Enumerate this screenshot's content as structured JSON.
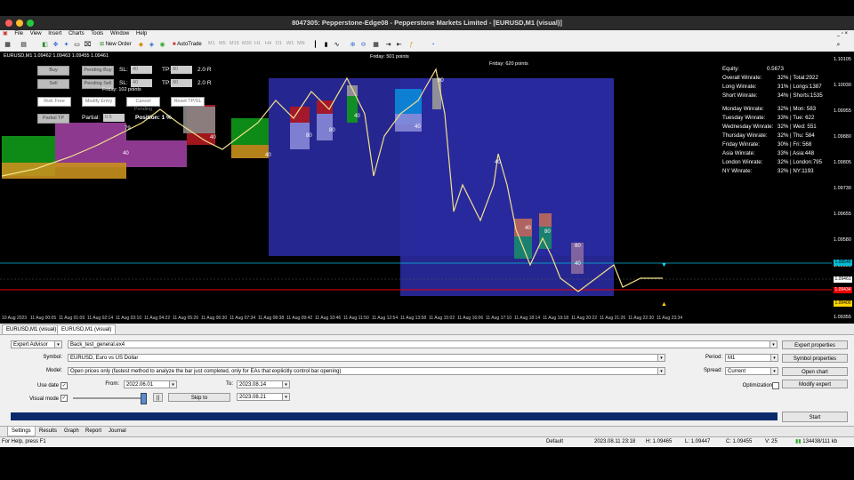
{
  "window": {
    "title": "8047305: Pepperstone-Edge08 - Pepperstone Markets Limited - [EURUSD,M1 (visual)]"
  },
  "menu": [
    "File",
    "View",
    "Insert",
    "Charts",
    "Tools",
    "Window",
    "Help"
  ],
  "toolbar": {
    "new_order": "New Order",
    "autotrade": "AutoTrade",
    "timeframes": [
      "M1",
      "M5",
      "M15",
      "M30",
      "H1",
      "H4",
      "D1",
      "W1",
      "MN"
    ]
  },
  "chart": {
    "symbol_label": "EURUSD,M1 1.09462 1.09463 1.09455 1.09461",
    "panel": {
      "buy": "Buy",
      "sell": "Sell",
      "pending_buy": "Pending Buy",
      "pending_sell": "Pending Sell",
      "sl_label": "SL:",
      "tp_label": "TP:",
      "sl_buy": "40",
      "sl_sell": "40",
      "tp_buy": "80",
      "tp_sell": "80",
      "rr_buy": "2.0 R",
      "rr_sell": "2.0 R",
      "risk_free": "Risk Free",
      "modify_entry": "Modify Entry",
      "cancel_pending": "Cancel Pending",
      "reset_tpsl": "Reset TP/SL",
      "partial_tp": "Partial TP",
      "partial_label": "Partial:",
      "partial_value": "0.5",
      "position_label": "Position: 1 %"
    },
    "annotations": {
      "friday1": "Friday: 102 points",
      "friday2": "Friday: 501 points",
      "friday3": "Friday: 620 points"
    },
    "box_labels": [
      "40",
      "79",
      "40",
      "40",
      "80",
      "80",
      "40",
      "80",
      "40",
      "40",
      "40",
      "80",
      "80",
      "40",
      "80"
    ],
    "stats": [
      {
        "label": "Equity:",
        "value": "0.5673",
        "rest": ""
      },
      {
        "label": "Overall Winrate:",
        "value": "32%",
        "rest": "| Total:2922"
      },
      {
        "label": "Long Winrate:",
        "value": "31%",
        "rest": "| Longs:1387"
      },
      {
        "label": "Short Winrate:",
        "value": "34%",
        "rest": "| Shorts:1535"
      },
      {
        "label": "Monday Winrate:",
        "value": "32%",
        "rest": "| Mon: 583"
      },
      {
        "label": "Tuesday Winrate:",
        "value": "33%",
        "rest": "| Tue: 622"
      },
      {
        "label": "Wednesday Winrate:",
        "value": "32%",
        "rest": "| Wed: 551"
      },
      {
        "label": "Thursday Winrate:",
        "value": "32%",
        "rest": "| Thu: 584"
      },
      {
        "label": "Friday Winrate:",
        "value": "30%",
        "rest": "| Fri: 568"
      },
      {
        "label": "Asia Winrate:",
        "value": "33%",
        "rest": "| Asia:448"
      },
      {
        "label": "London Winrate:",
        "value": "32%",
        "rest": "| London:795"
      },
      {
        "label": "NY Winrate:",
        "value": "32%",
        "rest": "| NY:1193"
      }
    ],
    "price_axis": [
      "1.10105",
      "1.10030",
      "1.09955",
      "1.09880",
      "1.09805",
      "1.09730",
      "1.09655",
      "1.09580",
      "1.09505",
      "1.09430",
      "1.09355"
    ],
    "price_tags": {
      "cyan": "1.09546",
      "current": "1.09461",
      "red": "1.09434",
      "yellow": "1.09400"
    },
    "time_axis": [
      "10 Aug 2023",
      "11 Aug 00:05",
      "11 Aug 01:09",
      "11 Aug 02:14",
      "11 Aug 03:10",
      "11 Aug 04:22",
      "11 Aug 05:26",
      "11 Aug 06:30",
      "11 Aug 07:34",
      "11 Aug 08:38",
      "11 Aug 09:42",
      "11 Aug 10:46",
      "11 Aug 11:50",
      "11 Aug 12:54",
      "11 Aug 13:58",
      "11 Aug 15:02",
      "11 Aug 16:06",
      "11 Aug 17:10",
      "11 Aug 18:14",
      "11 Aug 19:18",
      "11 Aug 20:22",
      "11 Aug 21:26",
      "11 Aug 22:30",
      "11 Aug 23:34"
    ]
  },
  "chart_tabs": [
    "EURUSD,M1 (visual)",
    "EURUSD,M1 (visual)"
  ],
  "tester": {
    "type": "Expert Advisor",
    "expert": "Back_test_general.ex4",
    "symbol_label": "Symbol:",
    "symbol": "EURUSD, Euro vs US Dollar",
    "model_label": "Model:",
    "model": "Open prices only (fastest method to analyze the bar just completed, only for EAs that explicitly control bar opening)",
    "use_date_label": "Use date",
    "from_label": "From:",
    "from": "2022.06.01",
    "to_label": "To:",
    "to": "2023.08.14",
    "visual_label": "Visual mode",
    "skip_to": "Skip to",
    "skip_date": "2023.08.21",
    "pause": "||",
    "period_label": "Period:",
    "period": "M1",
    "spread_label": "Spread:",
    "spread": "Current",
    "optimization_label": "Optimization",
    "expert_properties": "Expert properties",
    "symbol_properties": "Symbol properties",
    "open_chart": "Open chart",
    "modify_expert": "Modify expert",
    "start": "Start"
  },
  "bottom_tabs": [
    "Settings",
    "Results",
    "Graph",
    "Report",
    "Journal"
  ],
  "status": {
    "help": "For Help, press F1",
    "profile": "Default",
    "datetime": "2023.08.11 23:18",
    "high": "H: 1.09465",
    "low": "L: 1.09447",
    "close": "C: 1.09455",
    "volume": "V: 25",
    "traffic": "134438/111 kb"
  },
  "colors": {
    "chart_bg": "#000000",
    "candle_line": "#f2e28a",
    "blue_zone": "#2a2aa0",
    "green_zone": "#0f9a1a",
    "purple_zone": "#9c3fa0"
  }
}
